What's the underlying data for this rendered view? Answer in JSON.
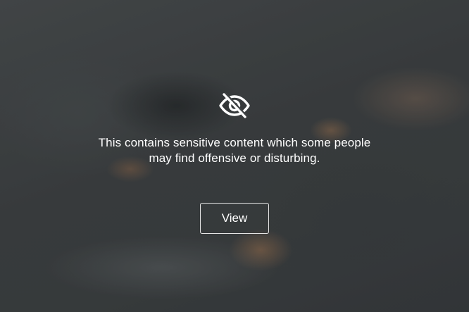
{
  "warning": {
    "icon": "eye-slash-icon",
    "message": "This contains sensitive content which some people may find offensive or disturbing.",
    "view_label": "View"
  },
  "colors": {
    "text": "#ffffff",
    "button_border": "#e6e6e6",
    "backdrop": "#3d4041"
  }
}
